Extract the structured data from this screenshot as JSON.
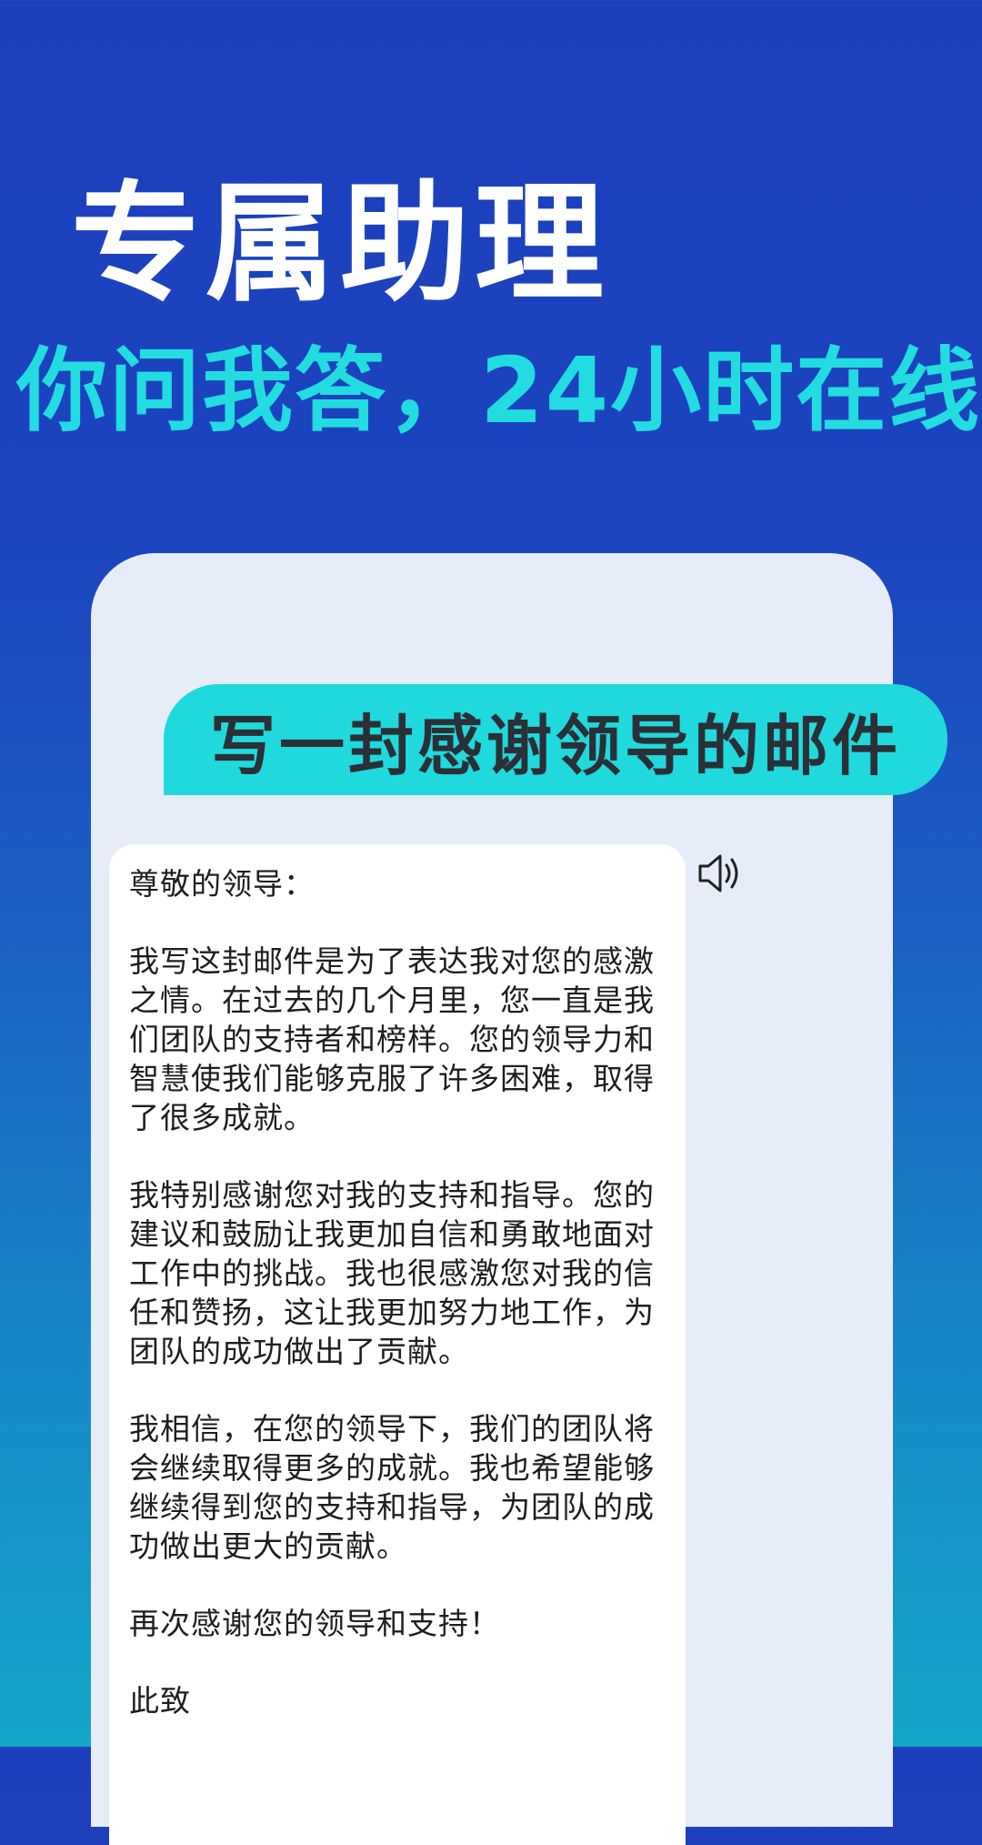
{
  "header": {
    "title": "专属助理",
    "subtitle": "你问我答，24小时在线"
  },
  "chat": {
    "user_message": "写一封感谢领导的邮件",
    "speaker_icon": "speaker-icon",
    "reply_paragraphs": [
      "尊敬的领导：",
      "我写这封邮件是为了表达我对您的感激之情。在过去的几个月里，您一直是我们团队的支持者和榜样。您的领导力和智慧使我们能够克服了许多困难，取得了很多成就。",
      "我特别感谢您对我的支持和指导。您的建议和鼓励让我更加自信和勇敢地面对工作中的挑战。我也很感激您对我的信任和赞扬，这让我更加努力地工作，为团队的成功做出了贡献。",
      "我相信，在您的领导下，我们的团队将会继续取得更多的成就。我也希望能够继续得到您的支持和指导，为团队的成功做出更大的贡献。",
      "再次感谢您的领导和支持！",
      "此致"
    ]
  },
  "colors": {
    "background_top": "#1d3fbd",
    "background_bottom": "#13a7c8",
    "accent_cyan": "#20d9dc",
    "panel": "#e6edf8"
  }
}
